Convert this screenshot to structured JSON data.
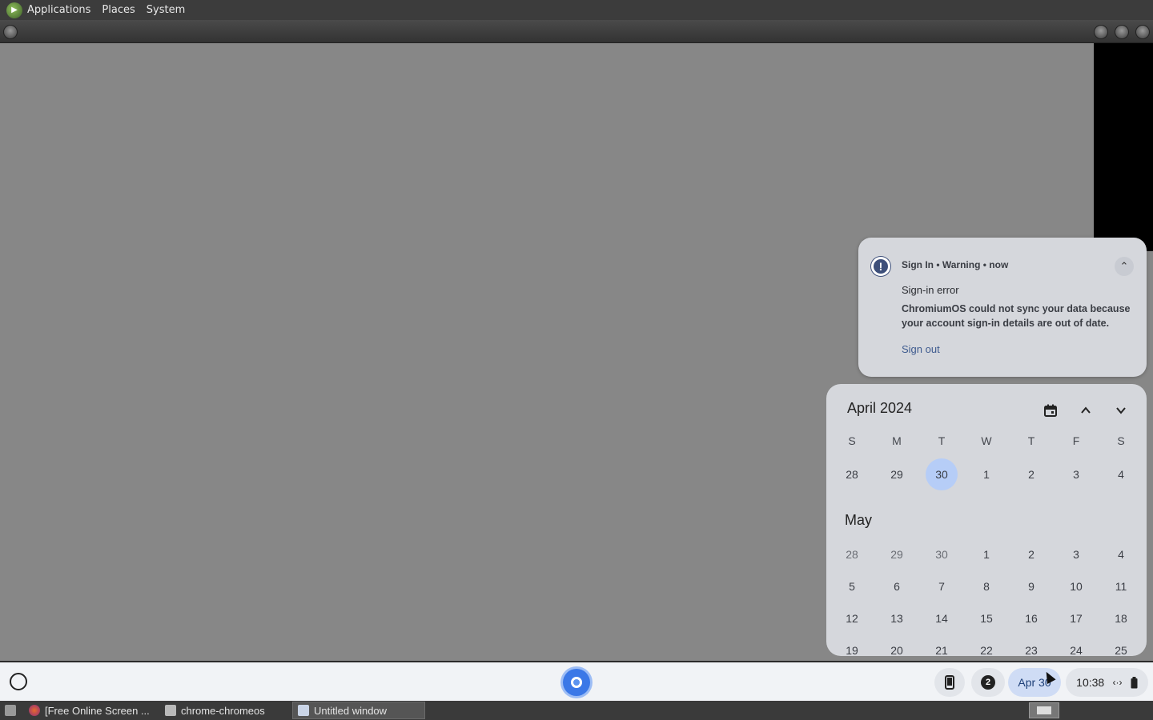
{
  "top_panel": {
    "menus": [
      "Applications",
      "Places",
      "System"
    ]
  },
  "notification": {
    "header": "Sign In • Warning • now",
    "title": "Sign-in error",
    "body": "ChromiumOS could not sync your data because your account sign-in details are out of date.",
    "action": "Sign out",
    "icon": "warning-icon"
  },
  "calendar": {
    "month_title": "April 2024",
    "weekdays": [
      "S",
      "M",
      "T",
      "W",
      "T",
      "F",
      "S"
    ],
    "april_rows": [
      [
        "28",
        "29",
        "30",
        "1",
        "2",
        "3",
        "4"
      ]
    ],
    "today": "30",
    "may_label": "May",
    "may_rows": [
      [
        "28",
        "29",
        "30",
        "1",
        "2",
        "3",
        "4"
      ],
      [
        "5",
        "6",
        "7",
        "8",
        "9",
        "10",
        "11"
      ],
      [
        "12",
        "13",
        "14",
        "15",
        "16",
        "17",
        "18"
      ],
      [
        "19",
        "20",
        "21",
        "22",
        "23",
        "24",
        "25"
      ]
    ]
  },
  "shelf": {
    "notification_count": "2",
    "date": "Apr 30",
    "time": "10:38"
  },
  "taskbar": {
    "tasks": [
      {
        "label": "[Free Online Screen ...",
        "icon": "firefox-icon",
        "active": false
      },
      {
        "label": "chrome-chromeos",
        "icon": "folder-icon",
        "active": false
      },
      {
        "label": "Untitled window",
        "icon": "window-icon",
        "active": true
      }
    ]
  },
  "colors": {
    "accent": "#b6cdf7",
    "link": "#3f5b8f",
    "desktop": "#878787"
  }
}
